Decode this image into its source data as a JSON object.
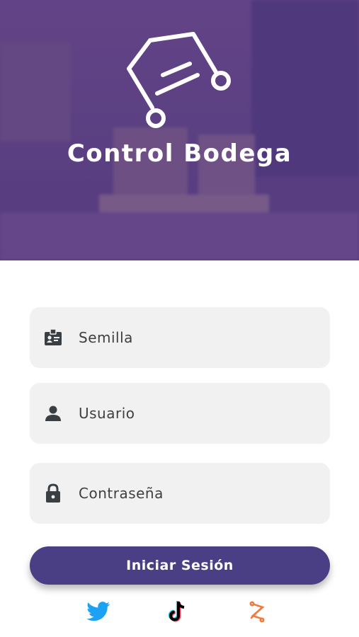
{
  "app": {
    "title": "Control Bodega"
  },
  "form": {
    "seed_placeholder": "Semilla",
    "user_placeholder": "Usuario",
    "password_placeholder": "Contraseña"
  },
  "actions": {
    "login_label": "Iniciar Sesión"
  },
  "social": [
    {
      "name": "twitter-icon",
      "color": "#1da1f2"
    },
    {
      "name": "tiktok-icon",
      "color": "#000000"
    },
    {
      "name": "brand-link-icon",
      "color": "#f07b3f"
    }
  ],
  "colors": {
    "primary": "#4a3f84",
    "hero_overlay": "#5f4784",
    "field_bg": "#f1f1f1",
    "icon": "#3a3f44"
  }
}
